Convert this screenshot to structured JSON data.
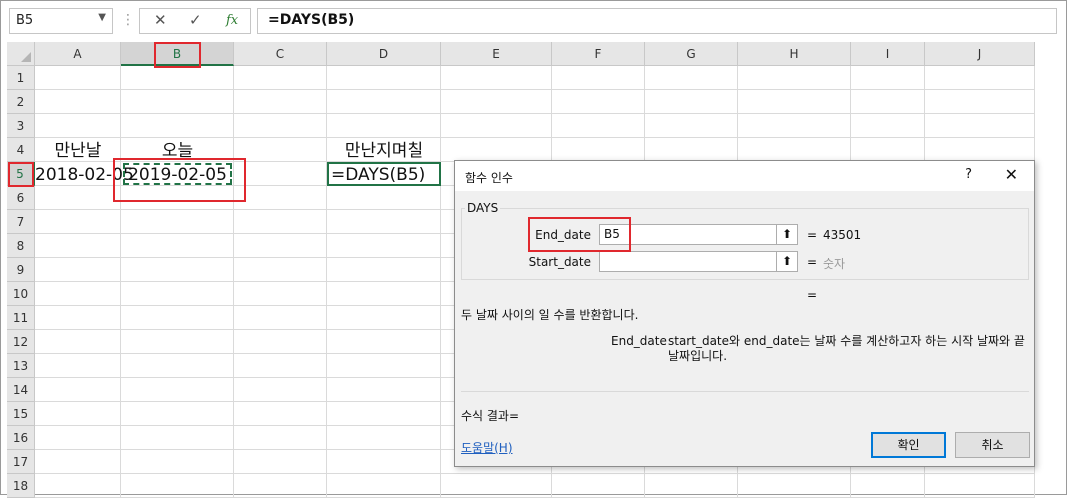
{
  "formula_bar": {
    "name_box": "B5",
    "cancel_icon": "✕",
    "enter_icon": "✓",
    "fx_label": "fx",
    "formula": "=DAYS(B5)"
  },
  "grid": {
    "columns": [
      "A",
      "B",
      "C",
      "D",
      "E",
      "F",
      "G",
      "H",
      "I",
      "J"
    ],
    "rows": [
      "1",
      "2",
      "3",
      "4",
      "5",
      "6",
      "7",
      "8",
      "9",
      "10",
      "11",
      "12",
      "13",
      "14",
      "15",
      "16",
      "17",
      "18"
    ],
    "cells": {
      "A4": "만난날",
      "B4": "오늘",
      "D4": "만난지며칠",
      "A5": "2018-02-05",
      "B5": "2019-02-05",
      "D5": "=DAYS(B5)"
    },
    "selected_column": "B",
    "selected_row": "5"
  },
  "dialog": {
    "title": "함수 인수",
    "help_glyph": "?",
    "close_glyph": "✕",
    "function_name": "DAYS",
    "args": [
      {
        "label": "End_date",
        "value": "B5",
        "result": "43501"
      },
      {
        "label": "Start_date",
        "value": "",
        "result": "숫자"
      }
    ],
    "equals": "=",
    "description": "두 날짜 사이의 일 수를 반환합니다.",
    "arg_help_name": "End_date",
    "arg_help_text": "start_date와 end_date는 날짜 수를 계산하고자 하는 시작 날짜와 끝 날짜입니다.",
    "formula_result_label": "수식 결과=",
    "help_link": "도움말(H)",
    "ok_label": "확인",
    "cancel_label": "취소"
  },
  "colors": {
    "accent_green": "#217346",
    "highlight_red": "#e0282e",
    "link_blue": "#1f5fbf",
    "primary_button_border": "#0078d7"
  }
}
